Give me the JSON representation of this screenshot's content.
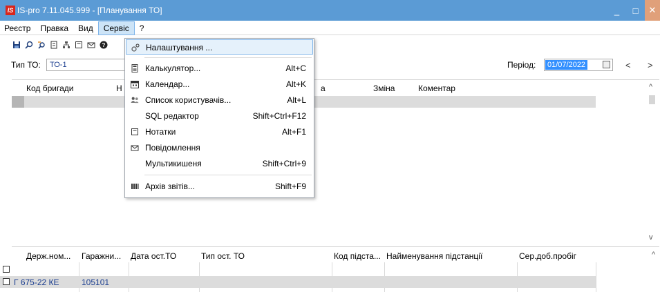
{
  "titlebar": {
    "logo": "IS",
    "title": "IS-pro 7.11.045.999 - [Планування ТО]",
    "min": "_",
    "max": "□",
    "close": "✕"
  },
  "menubar": [
    "Реєстр",
    "Правка",
    "Вид",
    "Сервіс",
    "?"
  ],
  "toolbar": {
    "icons": [
      "save-icon",
      "find-icon",
      "find-next-icon",
      "filter-icon",
      "tree-icon",
      "notes-icon",
      "mail-icon",
      "help-icon"
    ]
  },
  "filter": {
    "type_label": "Тип ТО:",
    "type_value": "ТО-1",
    "period_label": "Період:",
    "period_value": "01/07/2022",
    "prev": "<",
    "next": ">"
  },
  "top_grid": {
    "headers": [
      "Код бригади",
      "Н",
      "а",
      "Зміна",
      "Коментар"
    ],
    "scroll_up": "^",
    "scroll_down": "v"
  },
  "bottom_grid": {
    "headers": [
      "Держ.ном...",
      "Гаражни...",
      "Дата ост.ТО",
      "Тип ост. ТО",
      "Код підста...",
      "Найменування підстанції",
      "Сер.доб.пробіг"
    ],
    "rows": [
      {
        "plate": "",
        "garage": ""
      },
      {
        "plate": "Г 675-22 КЕ",
        "garage": "105101"
      }
    ],
    "scroll_up": "^"
  },
  "service_menu": {
    "items": [
      {
        "label": "Налаштування ...",
        "shortcut": "",
        "icon": "settings-icon"
      },
      {
        "label": "Калькулятор...",
        "shortcut": "Alt+C",
        "icon": "calculator-icon"
      },
      {
        "label": "Календар...",
        "shortcut": "Alt+K",
        "icon": "calendar-icon"
      },
      {
        "label": "Список користувачів...",
        "shortcut": "Alt+L",
        "icon": "users-icon"
      },
      {
        "label": "SQL редактор",
        "shortcut": "Shift+Ctrl+F12",
        "icon": ""
      },
      {
        "label": "Нотатки",
        "shortcut": "Alt+F1",
        "icon": "notes-icon"
      },
      {
        "label": "Повідомлення",
        "shortcut": "",
        "icon": "mail-icon"
      },
      {
        "label": "Мультикишеня",
        "shortcut": "Shift+Ctrl+9",
        "icon": ""
      },
      {
        "label": "Архів звітів...",
        "shortcut": "Shift+F9",
        "icon": "archive-icon"
      }
    ]
  },
  "colors": {
    "titlebar": "#5b9bd5",
    "menu_highlight": "#cde4f7",
    "selection": "#3390ff",
    "link_text": "#1a3d8f"
  }
}
